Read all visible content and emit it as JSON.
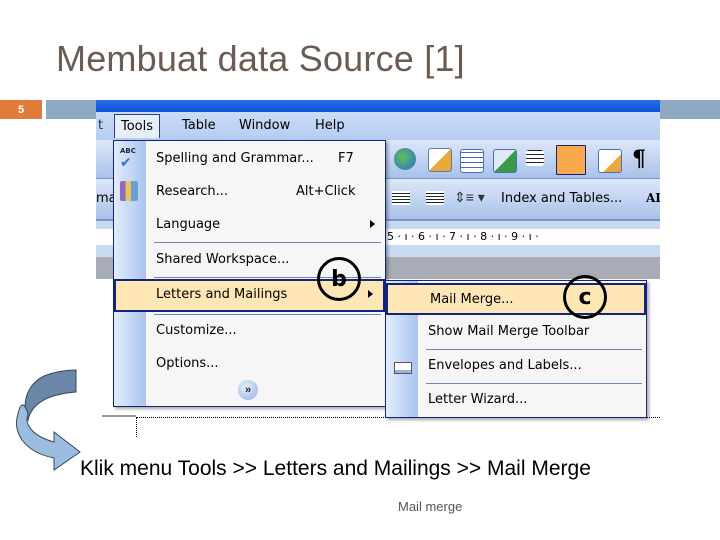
{
  "slide": {
    "title": "Membuat data Source [1]",
    "number": "5",
    "instruction": "Klik menu Tools >> Letters and Mailings >> Mail Merge",
    "footer": "Mail merge"
  },
  "colors": {
    "title": "#6b5b53",
    "slide_number_bg": "#e07b3c",
    "band": "#8fa9c4",
    "menu_highlight": "#ffe6b5",
    "menu_border": "#13247a"
  },
  "word": {
    "menubar": [
      {
        "label": "Tools",
        "active": true
      },
      {
        "label": "Table"
      },
      {
        "label": "Window"
      },
      {
        "label": "Help"
      }
    ],
    "menubar_cut_left": "t",
    "toolbar2_left_text": "ma",
    "toolbar2_text": "Index and Tables...",
    "toolbar2_right_cut": "AI",
    "pilcrow": "¶",
    "ruler": "· 5 · ı · 6 · ı · 7 · ı · 8 · ı · 9 · ı ·",
    "tools_menu": [
      {
        "label": "Spelling and Grammar...",
        "shortcut": "F7",
        "icon": "spelling-abc-icon"
      },
      {
        "label": "Research...",
        "shortcut": "Alt+Click",
        "icon": "research-books-icon"
      },
      {
        "label": "Language",
        "submenu": true
      },
      {
        "label": "Shared Workspace..."
      },
      {
        "label": "Letters and Mailings",
        "submenu": true,
        "highlighted": true
      },
      {
        "label": "Customize..."
      },
      {
        "label": "Options..."
      }
    ],
    "tools_menu_expand_icon": "double-chevron-down-icon",
    "letters_submenu": [
      {
        "label": "Mail Merge...",
        "highlighted": true
      },
      {
        "label": "Show Mail Merge Toolbar"
      },
      {
        "label": "Envelopes and Labels...",
        "icon": "envelope-icon"
      },
      {
        "label": "Letter Wizard..."
      }
    ]
  },
  "annotations": {
    "b": "b",
    "c": "c"
  }
}
